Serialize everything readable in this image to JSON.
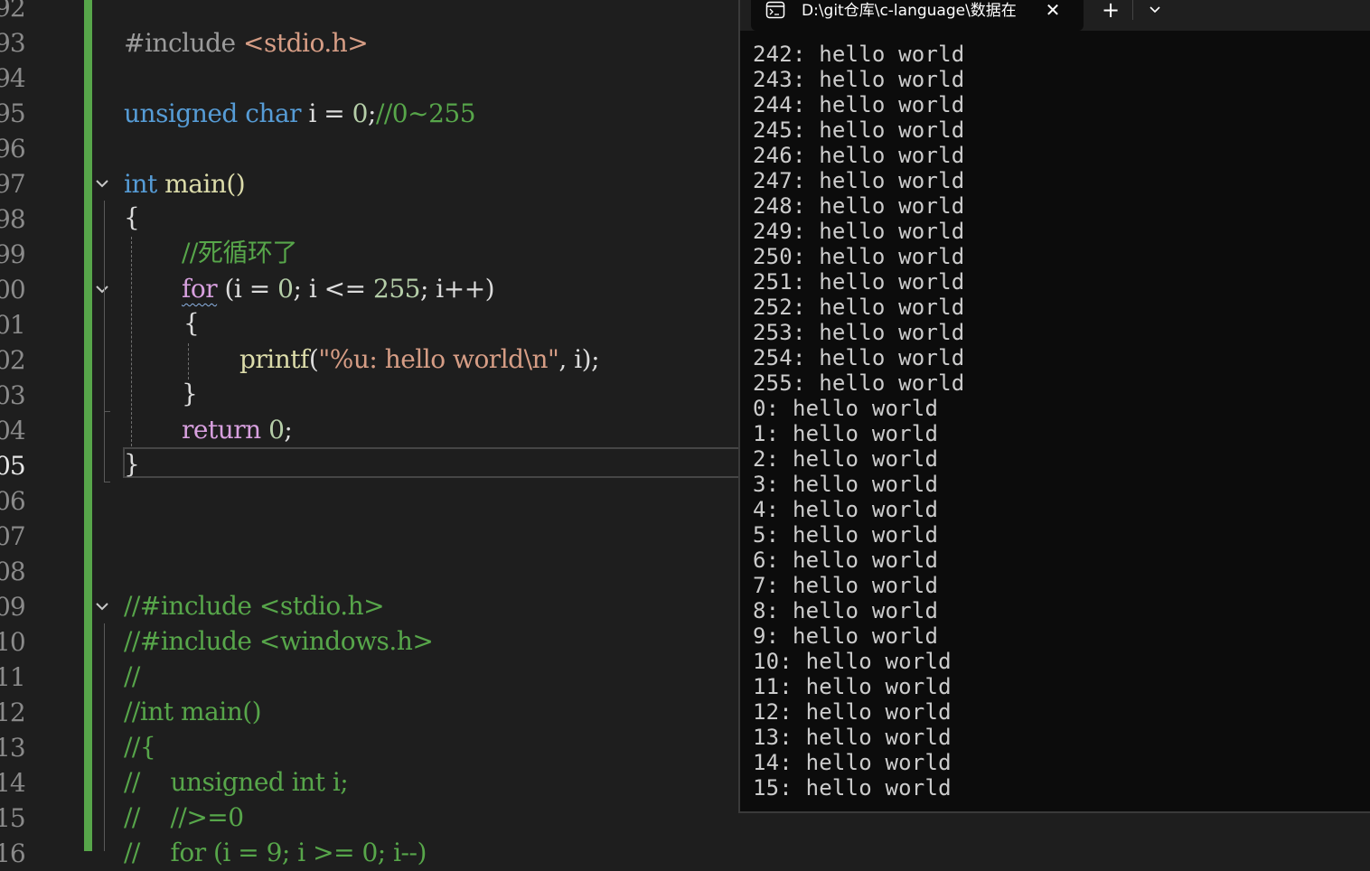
{
  "editor": {
    "line_numbers": [
      "92",
      "93",
      "94",
      "95",
      "96",
      "97",
      "98",
      "99",
      "00",
      "01",
      "02",
      "03",
      "04",
      "05",
      "06",
      "07",
      "08",
      "09",
      "10",
      "11",
      "12",
      "13",
      "14",
      "15",
      "16"
    ],
    "current_line": "05",
    "code": {
      "l93": {
        "a": "#include ",
        "b": "<stdio.h>"
      },
      "l95": {
        "a": "unsigned",
        "b": " ",
        "c": "char",
        "d": " i = ",
        "e": "0",
        "f": ";",
        "g": "//0~255"
      },
      "l97": {
        "a": "int",
        "b": " main()"
      },
      "l98": "{",
      "l99": "//死循环了",
      "l100": {
        "a": "for",
        "b": " (i = ",
        "c": "0",
        "d": "; i <= ",
        "e": "255",
        "f": "; i++)"
      },
      "l101": "{",
      "l102": {
        "a": "printf",
        "b": "(",
        "c": "\"%u: hello world\\n\"",
        "d": ", i);"
      },
      "l103": "}",
      "l104": {
        "a": "return",
        "b": " ",
        "c": "0",
        "d": ";"
      },
      "l105": "}",
      "l109": "//#include <stdio.h>",
      "l110": "//#include <windows.h>",
      "l111": "//",
      "l112": "//int main()",
      "l113": "//{",
      "l114": "//    unsigned int i;",
      "l115": "//    //>=0",
      "l116": "//    for (i = 9; i >= 0; i--)"
    }
  },
  "terminal": {
    "tab_title": "D:\\git仓库\\c-language\\数据在",
    "tab_close": "✕",
    "new_tab": "+",
    "lines": [
      "242: hello world",
      "243: hello world",
      "244: hello world",
      "245: hello world",
      "246: hello world",
      "247: hello world",
      "248: hello world",
      "249: hello world",
      "250: hello world",
      "251: hello world",
      "252: hello world",
      "253: hello world",
      "254: hello world",
      "255: hello world",
      "0: hello world",
      "1: hello world",
      "2: hello world",
      "3: hello world",
      "4: hello world",
      "5: hello world",
      "6: hello world",
      "7: hello world",
      "8: hello world",
      "9: hello world",
      "10: hello world",
      "11: hello world",
      "12: hello world",
      "13: hello world",
      "14: hello world",
      "15: hello world"
    ]
  },
  "colors": {
    "editor_bg": "#1e1e1e",
    "change_bar": "#57a64a",
    "keyword": "#569cd6",
    "control_keyword": "#d8a0df",
    "comment": "#57a64a",
    "string": "#d69d85",
    "number": "#b5cea8",
    "function": "#dcdcaa",
    "terminal_bg": "#0c0c0c"
  }
}
